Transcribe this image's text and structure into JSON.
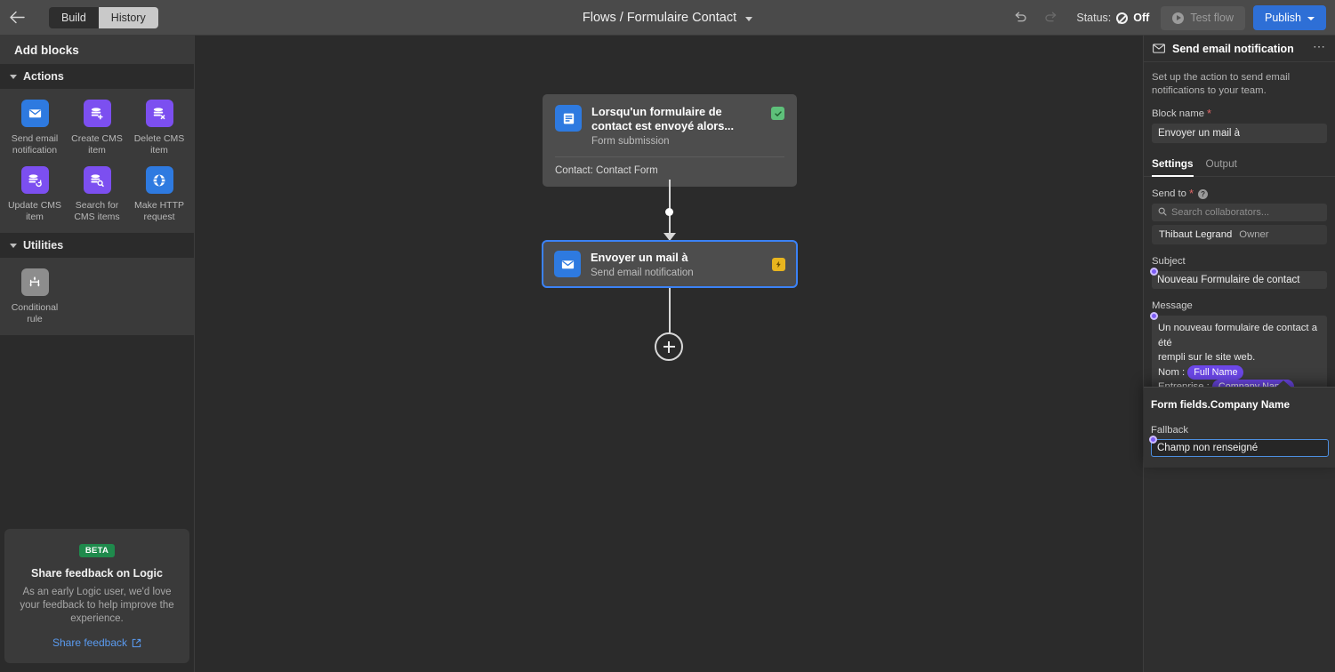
{
  "topbar": {
    "back_icon": "arrow-left-icon",
    "tabs": [
      {
        "label": "Build",
        "active": false
      },
      {
        "label": "History",
        "active": true
      }
    ],
    "breadcrumb": "Flows / Formulaire Contact",
    "undo_icon": "undo-icon",
    "redo_icon": "redo-icon",
    "status_label": "Status:",
    "status_value": "Off",
    "test_flow_label": "Test flow",
    "publish_label": "Publish"
  },
  "sidebar": {
    "header": "Add blocks",
    "groups": [
      {
        "name": "Actions",
        "items": [
          {
            "label": "Send email notification",
            "icon": "envelope-icon",
            "color": "#2e7ae0"
          },
          {
            "label": "Create CMS item",
            "icon": "database-plus-icon",
            "color": "#7c4ff0"
          },
          {
            "label": "Delete CMS item",
            "icon": "database-x-icon",
            "color": "#7c4ff0"
          },
          {
            "label": "Update CMS item",
            "icon": "database-refresh-icon",
            "color": "#7c4ff0"
          },
          {
            "label": "Search for CMS items",
            "icon": "database-search-icon",
            "color": "#7c4ff0"
          },
          {
            "label": "Make HTTP request",
            "icon": "globe-icon",
            "color": "#2e7ae0"
          }
        ]
      },
      {
        "name": "Utilities",
        "items": [
          {
            "label": "Conditional rule",
            "icon": "branch-icon",
            "color": "#8d8d8d"
          }
        ]
      }
    ],
    "feedback": {
      "badge": "BETA",
      "title": "Share feedback on Logic",
      "body": "As an early Logic user, we'd love your feedback to help improve the experience.",
      "link": "Share feedback",
      "link_icon": "external-link-icon"
    }
  },
  "canvas": {
    "trigger_node": {
      "icon": "form-icon",
      "title": "Lorsqu'un formulaire de contact est envoyé alors...",
      "subtitle": "Form submission",
      "meta": "Contact: Contact Form",
      "status_icon": "check-icon"
    },
    "action_node": {
      "icon": "envelope-icon",
      "title": "Envoyer un mail à",
      "subtitle": "Send email notification",
      "status_icon": "warning-icon"
    },
    "add_block_icon": "plus-icon"
  },
  "rightpanel": {
    "icon": "envelope-icon",
    "title": "Send email notification",
    "menu_icon": "ellipsis-icon",
    "description": "Set up the action to send email notifications to your team.",
    "block_name_label": "Block name",
    "block_name_value": "Envoyer un mail à",
    "tabs": [
      {
        "label": "Settings",
        "active": true
      },
      {
        "label": "Output",
        "active": false
      }
    ],
    "send_to_label": "Send to",
    "search_placeholder": "Search collaborators...",
    "search_icon": "search-icon",
    "collaborator": {
      "name": "Thibaut Legrand",
      "role": "Owner"
    },
    "subject_label": "Subject",
    "subject_value": "Nouveau Formulaire de contact",
    "message_label": "Message",
    "message_lines": [
      "Un nouveau formulaire de contact a été",
      "rempli sur le site web."
    ],
    "message_fields": [
      {
        "prefix": "Nom :",
        "pill": "Full Name"
      },
      {
        "prefix": "Entreprise :",
        "pill": "Company Name"
      }
    ],
    "popover": {
      "title": "Form fields.Company Name",
      "fallback_label": "Fallback",
      "fallback_value": "Champ non renseigné"
    }
  },
  "colors": {
    "accent_blue": "#2e6fd6",
    "selection_blue": "#3b82f6",
    "pill_purple": "#6c47e8",
    "success_green": "#5ec07a",
    "warning_yellow": "#e8b51f",
    "beta_green": "#1f8a4c"
  }
}
